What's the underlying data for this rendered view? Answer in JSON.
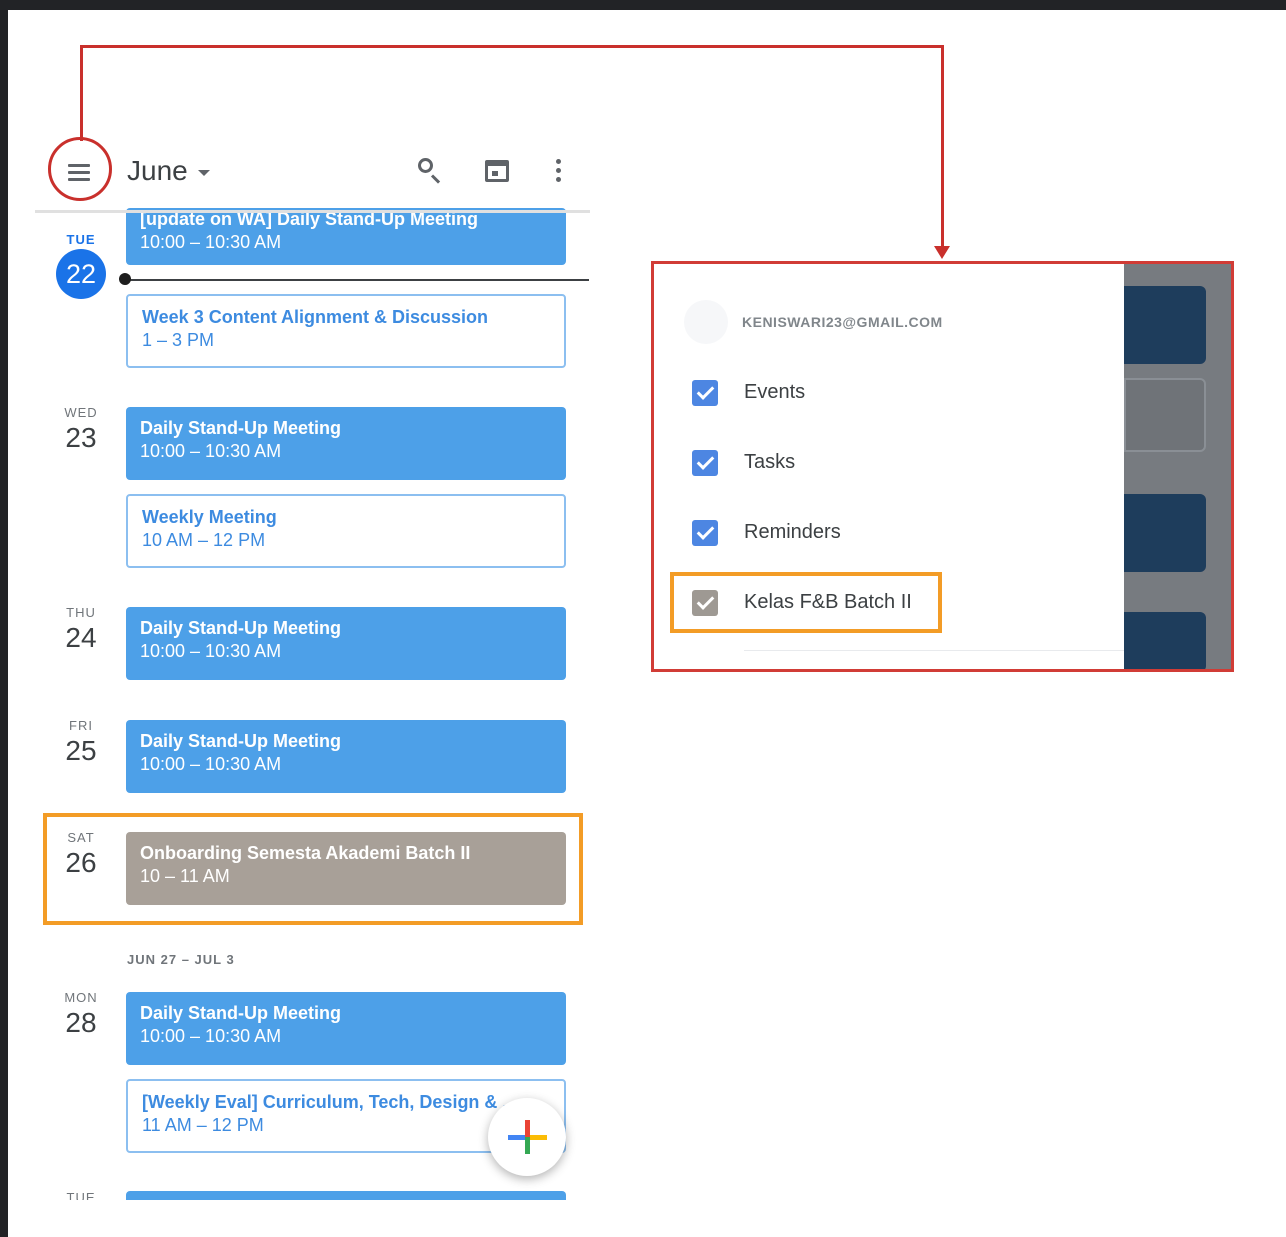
{
  "app": {
    "month_label": "June"
  },
  "days": [
    {
      "dow": "TUE",
      "num": "22"
    },
    {
      "dow": "WED",
      "num": "23"
    },
    {
      "dow": "THU",
      "num": "24"
    },
    {
      "dow": "FRI",
      "num": "25"
    },
    {
      "dow": "SAT",
      "num": "26"
    },
    {
      "dow": "MON",
      "num": "28"
    },
    {
      "dow": "TUE",
      "num": ""
    }
  ],
  "week_label": "JUN 27 – JUL 3",
  "events": [
    {
      "title": "[update on WA] Daily Stand-Up Meeting",
      "time": "10:00 – 10:30 AM"
    },
    {
      "title": "Week 3 Content Alignment & Discussion",
      "time": "1 – 3 PM"
    },
    {
      "title": "Daily Stand-Up Meeting",
      "time": "10:00 – 10:30 AM"
    },
    {
      "title": "Weekly Meeting",
      "time": "10 AM – 12 PM"
    },
    {
      "title": "Daily Stand-Up Meeting",
      "time": "10:00 – 10:30 AM"
    },
    {
      "title": "Daily Stand-Up Meeting",
      "time": "10:00 – 10:30 AM"
    },
    {
      "title": "Onboarding Semesta Akademi Batch II",
      "time": "10 – 11 AM"
    },
    {
      "title": "Daily Stand-Up Meeting",
      "time": "10:00 – 10:30 AM"
    },
    {
      "title": "[Weekly Eval] Curriculum, Tech, Design & ...",
      "time": "11 AM – 12 PM"
    }
  ],
  "drawer": {
    "email": "KENISWARI23@GMAIL.COM",
    "calendars": [
      {
        "label": "Events",
        "checked": true,
        "color": "#4d86e2"
      },
      {
        "label": "Tasks",
        "checked": true,
        "color": "#4d86e2"
      },
      {
        "label": "Reminders",
        "checked": true,
        "color": "#4d86e2"
      },
      {
        "label": "Kelas F&B Batch II",
        "checked": true,
        "color": "#9e9993"
      }
    ]
  },
  "colors": {
    "accent": "#1a73e8",
    "event_blue": "#4da0e8",
    "event_grey": "#a8a098",
    "annotation_red": "#c9302c",
    "annotation_orange": "#f39c26"
  }
}
